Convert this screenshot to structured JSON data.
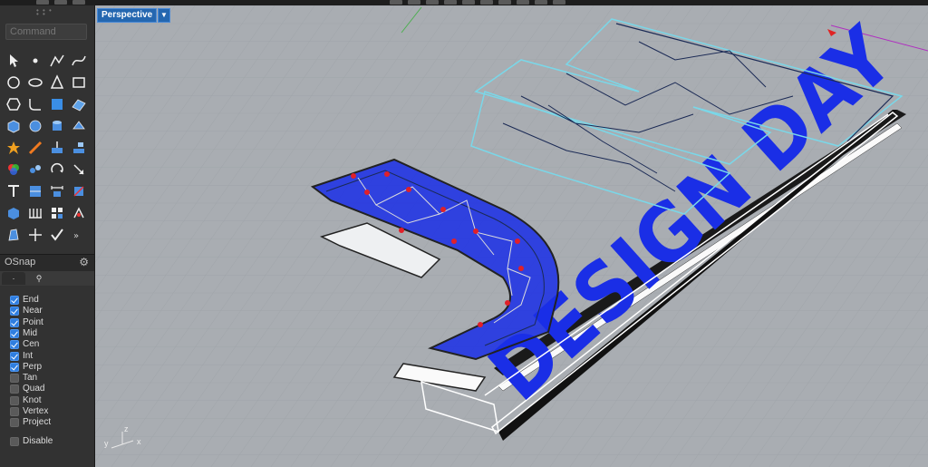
{
  "command": {
    "placeholder": "Command"
  },
  "viewport": {
    "name": "Perspective",
    "dropdown_icon": "caret-down"
  },
  "osnap": {
    "title": "OSnap",
    "gear_icon": "gear",
    "tabs": [
      "·",
      "filter"
    ],
    "items": [
      {
        "label": "End",
        "checked": true
      },
      {
        "label": "Near",
        "checked": true
      },
      {
        "label": "Point",
        "checked": true
      },
      {
        "label": "Mid",
        "checked": true
      },
      {
        "label": "Cen",
        "checked": true
      },
      {
        "label": "Int",
        "checked": true
      },
      {
        "label": "Perp",
        "checked": true
      },
      {
        "label": "Tan",
        "checked": false
      },
      {
        "label": "Quad",
        "checked": false
      },
      {
        "label": "Knot",
        "checked": false
      },
      {
        "label": "Vertex",
        "checked": false
      },
      {
        "label": "Project",
        "checked": false
      }
    ],
    "disable": {
      "label": "Disable",
      "checked": false
    }
  },
  "scene": {
    "text": "DESIGN DAY",
    "accent": "#1a2ee6",
    "mesh_color": "#1b2a55",
    "node_color": "#e0202a",
    "grid_bg": "#a9adb2"
  },
  "axes": {
    "z": "z",
    "y": "y",
    "x": "x"
  }
}
